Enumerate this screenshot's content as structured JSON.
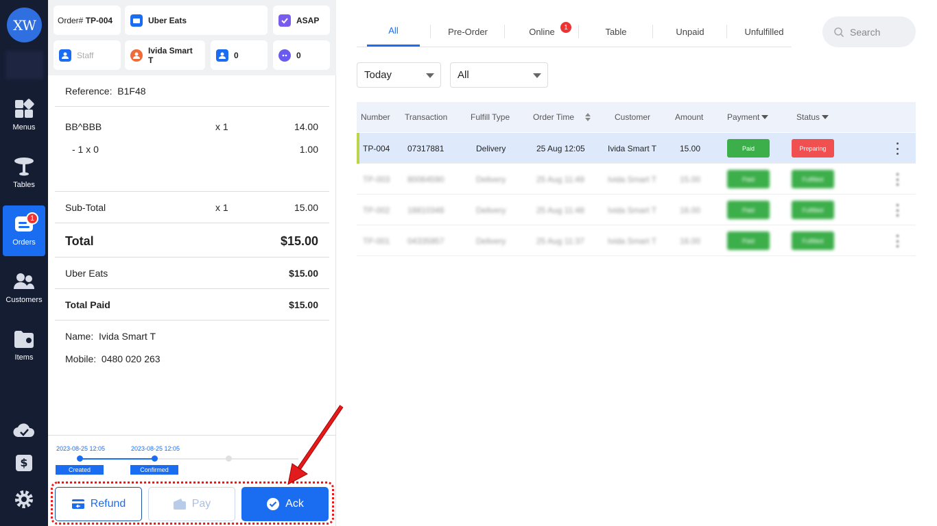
{
  "app": {
    "logo_text": "XW",
    "nav": [
      {
        "label": "Menus",
        "icon": "menus-icon"
      },
      {
        "label": "Tables",
        "icon": "tables-icon"
      },
      {
        "label": "Orders",
        "icon": "orders-icon",
        "badge": "1",
        "active": true
      },
      {
        "label": "Customers",
        "icon": "customers-icon"
      },
      {
        "label": "Items",
        "icon": "items-icon"
      }
    ],
    "bottom_icons": [
      "cloud-check-icon",
      "cash-register-icon",
      "settings-gear-icon"
    ]
  },
  "order": {
    "order_label": "Order#",
    "order_number": "TP-004",
    "channel": "Uber Eats",
    "timing": "ASAP",
    "staff_placeholder": "Staff",
    "customer_name": "Ivida Smart T",
    "guest_count": "0",
    "extra_count": "0",
    "reference_label": "Reference:",
    "reference_value": "B1F48",
    "items": [
      {
        "name": "BB^BBB",
        "qty": "x 1",
        "price": "14.00"
      },
      {
        "name": "- 1 x 0",
        "qty": "",
        "price": "1.00"
      }
    ],
    "subtotal_label": "Sub-Total",
    "subtotal_qty": "x 1",
    "subtotal_value": "15.00",
    "total_label": "Total",
    "total_value": "$15.00",
    "payment_label": "Uber Eats",
    "payment_value": "$15.00",
    "total_paid_label": "Total Paid",
    "total_paid_value": "$15.00",
    "name_label": "Name:",
    "name_value": "Ivida Smart T",
    "mobile_label": "Mobile:",
    "mobile_value": "0480 020 263",
    "timeline": [
      {
        "date": "2023-08-25 12:05",
        "status": "Created",
        "done": true
      },
      {
        "date": "2023-08-25 12:05",
        "status": "Confirmed",
        "done": true
      },
      {
        "date": "",
        "status": "",
        "done": false
      }
    ],
    "buttons": {
      "refund": "Refund",
      "pay": "Pay",
      "ack": "Ack"
    }
  },
  "main": {
    "tabs": [
      {
        "label": "All",
        "active": true
      },
      {
        "label": "Pre-Order"
      },
      {
        "label": "Online",
        "badge": "1"
      },
      {
        "label": "Table"
      },
      {
        "label": "Unpaid"
      },
      {
        "label": "Unfulfilled"
      }
    ],
    "search_placeholder": "Search",
    "filter_date": "Today",
    "filter_type": "All",
    "columns": [
      "Number",
      "Transaction",
      "Fulfill Type",
      "Order Time",
      "Customer",
      "Amount",
      "Payment",
      "Status"
    ],
    "rows": [
      {
        "number": "TP-004",
        "transaction": "07317881",
        "fulfill": "Delivery",
        "time": "25 Aug 12:05",
        "customer": "Ivida Smart T",
        "amount": "15.00",
        "payment": "Paid",
        "status": "Preparing",
        "selected": true,
        "blurred": false
      },
      {
        "number": "TP-003",
        "transaction": "80064590",
        "fulfill": "Delivery",
        "time": "25 Aug 11:49",
        "customer": "Ivida Smart T",
        "amount": "15.00",
        "payment": "Paid",
        "status": "Fulfilled",
        "selected": false,
        "blurred": true
      },
      {
        "number": "TP-002",
        "transaction": "18810348",
        "fulfill": "Delivery",
        "time": "25 Aug 11:48",
        "customer": "Ivida Smart T",
        "amount": "16.00",
        "payment": "Paid",
        "status": "Fulfilled",
        "selected": false,
        "blurred": true
      },
      {
        "number": "TP-001",
        "transaction": "04335957",
        "fulfill": "Delivery",
        "time": "25 Aug 11:37",
        "customer": "Ivida Smart T",
        "amount": "16.00",
        "payment": "Paid",
        "status": "Fulfilled",
        "selected": false,
        "blurred": true
      }
    ],
    "colors": {
      "accent": "#1a6cf0",
      "paid": "#3cae4a",
      "preparing": "#f05050",
      "sidebar": "#151d33"
    }
  }
}
